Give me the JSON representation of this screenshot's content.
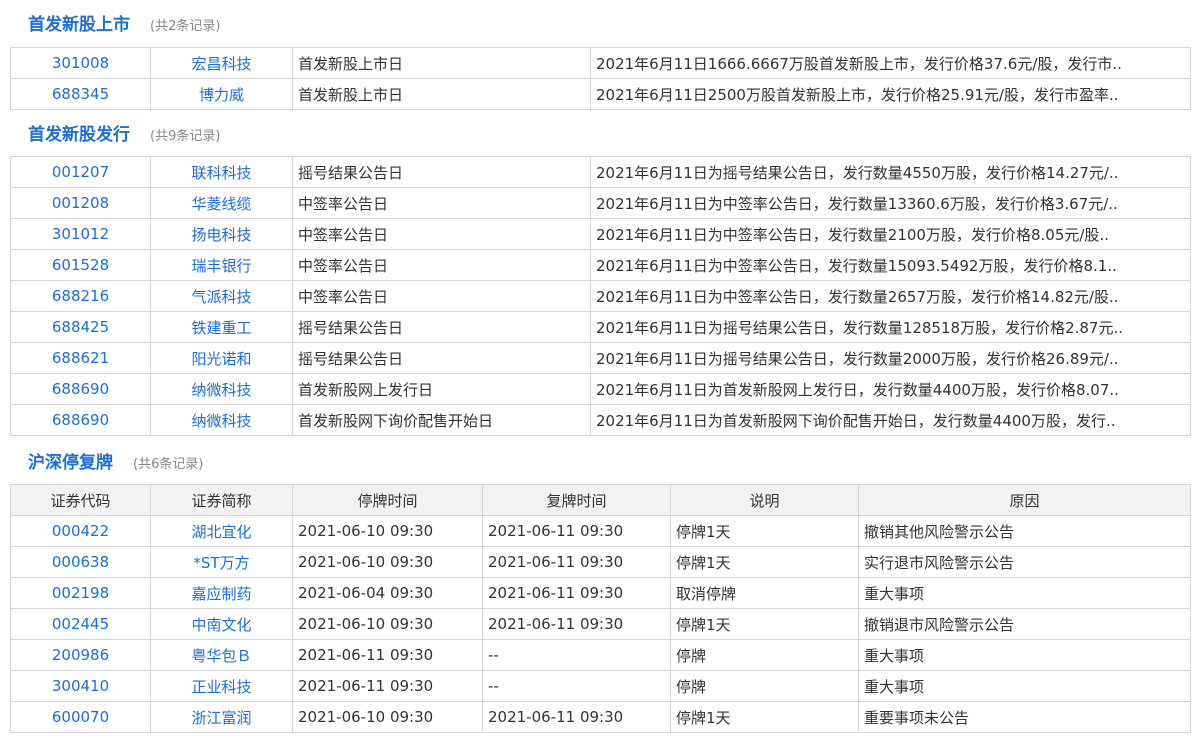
{
  "sections": [
    {
      "title": "首发新股上市",
      "count": "(共2条记录)",
      "rows": [
        {
          "code": "301008",
          "name": "宏昌科技",
          "event": "首发新股上市日",
          "desc": "2021年6月11日1666.6667万股首发新股上市，发行价格37.6元/股，发行市.."
        },
        {
          "code": "688345",
          "name": "博力威",
          "event": "首发新股上市日",
          "desc": "2021年6月11日2500万股首发新股上市，发行价格25.91元/股，发行市盈率.."
        }
      ]
    },
    {
      "title": "首发新股发行",
      "count": "(共9条记录)",
      "rows": [
        {
          "code": "001207",
          "name": "联科科技",
          "event": "摇号结果公告日",
          "desc": "2021年6月11日为摇号结果公告日，发行数量4550万股，发行价格14.27元/.."
        },
        {
          "code": "001208",
          "name": "华菱线缆",
          "event": "中签率公告日",
          "desc": "2021年6月11日为中签率公告日，发行数量13360.6万股，发行价格3.67元/.."
        },
        {
          "code": "301012",
          "name": "扬电科技",
          "event": "中签率公告日",
          "desc": "2021年6月11日为中签率公告日，发行数量2100万股，发行价格8.05元/股.."
        },
        {
          "code": "601528",
          "name": "瑞丰银行",
          "event": "中签率公告日",
          "desc": "2021年6月11日为中签率公告日，发行数量15093.5492万股，发行价格8.1.."
        },
        {
          "code": "688216",
          "name": "气派科技",
          "event": "中签率公告日",
          "desc": "2021年6月11日为中签率公告日，发行数量2657万股，发行价格14.82元/股.."
        },
        {
          "code": "688425",
          "name": "铁建重工",
          "event": "摇号结果公告日",
          "desc": "2021年6月11日为摇号结果公告日，发行数量128518万股，发行价格2.87元.."
        },
        {
          "code": "688621",
          "name": "阳光诺和",
          "event": "摇号结果公告日",
          "desc": "2021年6月11日为摇号结果公告日，发行数量2000万股，发行价格26.89元/.."
        },
        {
          "code": "688690",
          "name": "纳微科技",
          "event": "首发新股网上发行日",
          "desc": "2021年6月11日为首发新股网上发行日，发行数量4400万股，发行价格8.07.."
        },
        {
          "code": "688690",
          "name": "纳微科技",
          "event": "首发新股网下询价配售开始日",
          "desc": "2021年6月11日为首发新股网下询价配售开始日，发行数量4400万股，发行.."
        }
      ]
    },
    {
      "title": "沪深停复牌",
      "count": "(共6条记录)",
      "headers": [
        "证券代码",
        "证券简称",
        "停牌时间",
        "复牌时间",
        "说明",
        "原因"
      ],
      "rows": [
        {
          "code": "000422",
          "name": "湖北宜化",
          "halt": "2021-06-10 09:30",
          "resume": "2021-06-11 09:30",
          "note": "停牌1天",
          "reason": "撤销其他风险警示公告"
        },
        {
          "code": "000638",
          "name": "*ST万方",
          "halt": "2021-06-10 09:30",
          "resume": "2021-06-11 09:30",
          "note": "停牌1天",
          "reason": "实行退市风险警示公告"
        },
        {
          "code": "002198",
          "name": "嘉应制药",
          "halt": "2021-06-04 09:30",
          "resume": "2021-06-11 09:30",
          "note": "取消停牌",
          "reason": "重大事项"
        },
        {
          "code": "002445",
          "name": "中南文化",
          "halt": "2021-06-10 09:30",
          "resume": "2021-06-11 09:30",
          "note": "停牌1天",
          "reason": "撤销退市风险警示公告"
        },
        {
          "code": "200986",
          "name": "粤华包Ｂ",
          "halt": "2021-06-11 09:30",
          "resume": "--",
          "note": "停牌",
          "reason": "重大事项"
        },
        {
          "code": "300410",
          "name": "正业科技",
          "halt": "2021-06-11 09:30",
          "resume": "--",
          "note": "停牌",
          "reason": "重大事项"
        },
        {
          "code": "600070",
          "name": "浙江富润",
          "halt": "2021-06-10 09:30",
          "resume": "2021-06-11 09:30",
          "note": "停牌1天",
          "reason": "重要事项未公告"
        }
      ]
    }
  ]
}
